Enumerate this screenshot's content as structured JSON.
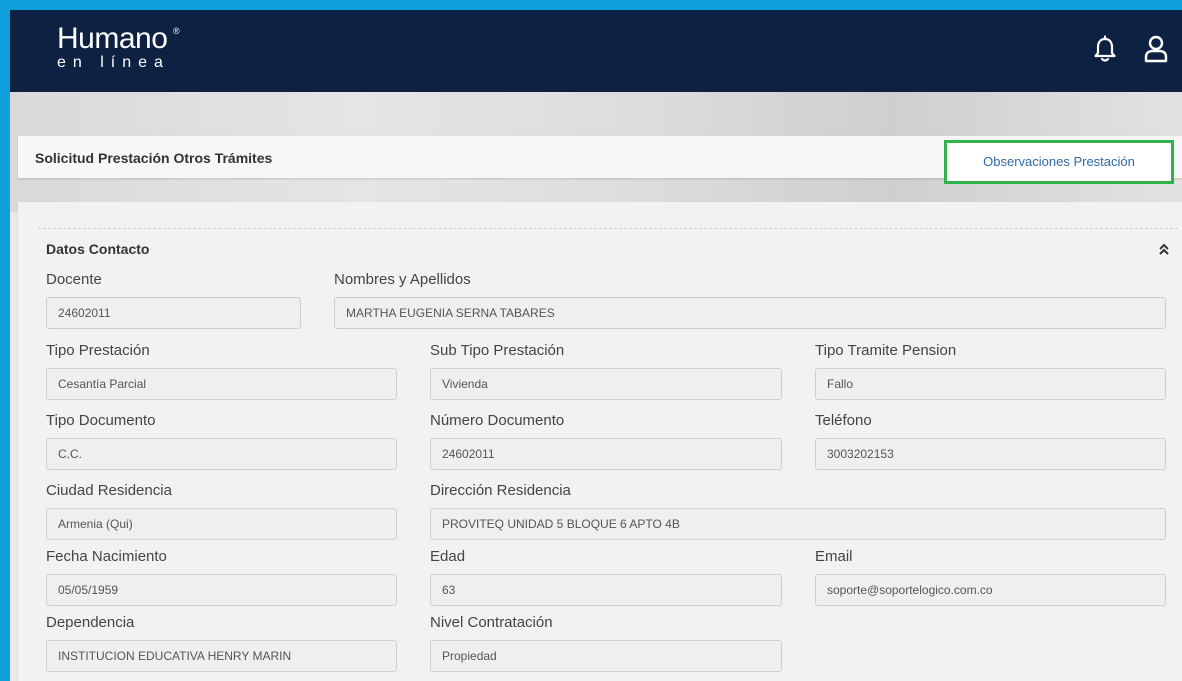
{
  "header": {
    "logo_main": "Humano",
    "logo_reg": "®",
    "logo_sub": "en línea"
  },
  "page": {
    "title": "Solicitud Prestación Otros Trámites",
    "observations_button": "Observaciones Prestación"
  },
  "section": {
    "title": "Datos Contacto"
  },
  "fields": {
    "docente": {
      "label": "Docente",
      "value": "24602011"
    },
    "nombres": {
      "label": "Nombres y Apellidos",
      "value": "MARTHA EUGENIA SERNA TABARES"
    },
    "tipo_prestacion": {
      "label": "Tipo Prestación",
      "value": "Cesantía Parcial"
    },
    "sub_tipo_prestacion": {
      "label": "Sub Tipo Prestación",
      "value": "Vivienda"
    },
    "tipo_tramite_pension": {
      "label": "Tipo Tramite Pension",
      "value": "Fallo"
    },
    "tipo_documento": {
      "label": "Tipo Documento",
      "value": "C.C."
    },
    "numero_documento": {
      "label": "Número Documento",
      "value": "24602011"
    },
    "telefono": {
      "label": "Teléfono",
      "value": "3003202153"
    },
    "ciudad_residencia": {
      "label": "Ciudad Residencia",
      "value": "Armenia (Qui)"
    },
    "direccion_residencia": {
      "label": "Dirección Residencia",
      "value": "PROVITEQ UNIDAD 5 BLOQUE 6 APTO 4B"
    },
    "fecha_nacimiento": {
      "label": "Fecha Nacimiento",
      "value": "05/05/1959"
    },
    "edad": {
      "label": "Edad",
      "value": "63"
    },
    "email": {
      "label": "Email",
      "value": "soporte@soportelogico.com.co"
    },
    "dependencia": {
      "label": "Dependencia",
      "value": "INSTITUCION EDUCATIVA HENRY MARIN"
    },
    "nivel_contratacion": {
      "label": "Nivel Contratación",
      "value": "Propiedad"
    }
  },
  "icons": {
    "bell": "bell-icon",
    "user": "user-icon",
    "collapse": "chevron-double-up-icon"
  },
  "colors": {
    "header_bg": "#0d2142",
    "frame_border": "#0e9fdc",
    "highlight": "#2fb34a",
    "link": "#2f6aa7"
  }
}
